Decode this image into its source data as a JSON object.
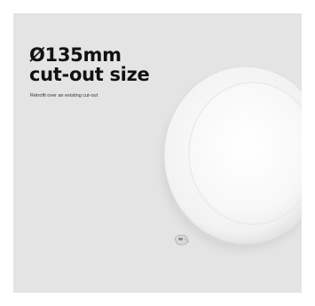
{
  "headline": {
    "line1": "Ø135mm",
    "line2": "cut-out size"
  },
  "subtext": "Retrofit over an existing cut-out",
  "product": {
    "icon": "round-led-panel-light",
    "colors": {
      "background": "#e4e4e4",
      "panel_rim": "#f7f7f7",
      "panel_face": "#fafafa"
    }
  }
}
